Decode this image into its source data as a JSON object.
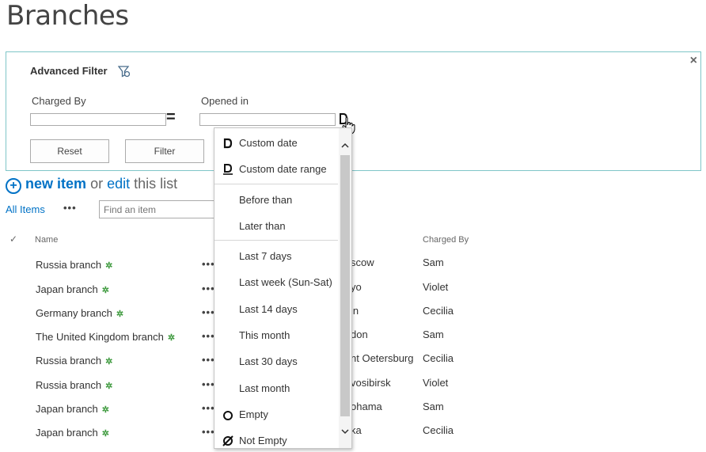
{
  "page": {
    "title": "Branches"
  },
  "filter": {
    "title": "Advanced Filter",
    "close": "×",
    "charged_by_label": "Charged By",
    "equals": "=",
    "opened_in_label": "Opened in",
    "reset_label": "Reset",
    "filter_label": "Filter"
  },
  "toolbar": {
    "plus": "+",
    "new_item": "new item",
    "or": "or",
    "edit": "edit",
    "this_list": "this list",
    "all_items": "All Items",
    "more": "•••",
    "search_placeholder": "Find an item"
  },
  "table": {
    "check_icon": "✓",
    "col_name": "Name",
    "col_charged_by": "Charged By",
    "rows": [
      {
        "name": "Russia branch",
        "city": "scow",
        "charged_by": "Sam"
      },
      {
        "name": "Japan branch",
        "city": "yo",
        "charged_by": "Violet"
      },
      {
        "name": "Germany branch",
        "city": "in",
        "charged_by": "Cecilia"
      },
      {
        "name": "The United Kingdom branch",
        "city": "don",
        "charged_by": "Sam"
      },
      {
        "name": "Russia branch",
        "city": "nt Oetersburg",
        "charged_by": "Cecilia"
      },
      {
        "name": "Russia branch",
        "city": "vosibirsk",
        "charged_by": "Violet"
      },
      {
        "name": "Japan branch",
        "city": "ohama",
        "charged_by": "Sam"
      },
      {
        "name": "Japan branch",
        "city": "ka",
        "charged_by": "Cecilia"
      }
    ],
    "new_badge": "✲",
    "row_menu": "•••"
  },
  "dropdown": {
    "items": [
      {
        "label": "Custom date",
        "icon": "custom-date-icon"
      },
      {
        "label": "Custom date range",
        "icon": "custom-date-range-icon"
      },
      {
        "label": "Before than"
      },
      {
        "label": "Later than"
      },
      {
        "label": "Last 7 days"
      },
      {
        "label": "Last week (Sun-Sat)"
      },
      {
        "label": "Last 14 days"
      },
      {
        "label": "This month"
      },
      {
        "label": "Last 30 days"
      },
      {
        "label": "Last month"
      },
      {
        "label": "Empty",
        "icon": "empty-circle-icon"
      },
      {
        "label": "Not Empty",
        "icon": "not-empty-icon"
      }
    ]
  },
  "colors": {
    "accent": "#0072c6",
    "panel_border": "#7fc5c8",
    "new_badge": "#3e9a3e"
  }
}
